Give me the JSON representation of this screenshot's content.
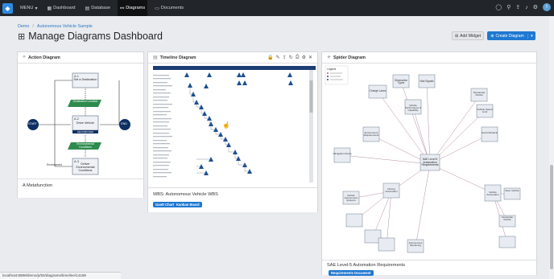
{
  "topbar": {
    "menu_label": "MENU",
    "items": [
      {
        "label": "Dashboard"
      },
      {
        "label": "Database"
      },
      {
        "label": "Diagrams"
      },
      {
        "label": "Documents"
      }
    ],
    "avatar_initial": "I"
  },
  "breadcrumb": {
    "root": "Demo",
    "project": "Autonomous Vehicle Sample"
  },
  "page": {
    "title": "Manage Diagrams Dashboard",
    "add_widget_label": "Add Widget",
    "create_diagram_label": "Create Diagram"
  },
  "action_panel": {
    "title": "Action Diagram",
    "nodes": [
      {
        "id": "A.1",
        "label": "Set a Destination"
      },
      {
        "id": "A.2",
        "label": "Drive Vehicle"
      },
      {
        "id": "A.3",
        "label": "Deliver Environmental Conditions"
      }
    ],
    "items": [
      "Destination Location",
      "Environmental Conditions"
    ],
    "start_label": "START",
    "end_label": "END",
    "branch_label": "Environment",
    "footer_title": "A Metafunction",
    "decomposed_label": "DECOMPOSED"
  },
  "timeline_panel": {
    "title": "Timeline Diagram",
    "footer_title": "WBS: Autonomous Vehicle WBS",
    "tags": [
      "Gantt Chart",
      "Kanban Board"
    ]
  },
  "spider_panel": {
    "title": "Spider Diagram",
    "center_label": "SAE Level 5 Automation Requirements",
    "footer_title": "SAE Level-5 Automation Requirements",
    "tag": "Requirements Document",
    "legend_title": "Legend",
    "nodes": [
      {
        "label": "Obstruction Types"
      },
      {
        "label": "Vital Signals"
      },
      {
        "label": "Change Lanes"
      },
      {
        "label": "Vehicle Performance & Capability"
      },
      {
        "label": "Environment Requirements"
      },
      {
        "label": "Vehicle Speed Limit"
      },
      {
        "label": "Driving Automation"
      },
      {
        "label": "Vehicle Automation"
      },
      {
        "label": "Steer Vehicle"
      },
      {
        "label": "Accelerate Vehicle"
      },
      {
        "label": "Decelerate Vehicle"
      },
      {
        "label": "Avoid Obstacle"
      },
      {
        "label": "Navigation Route"
      },
      {
        "label": "Vehicle Autonomous Systems"
      },
      {
        "label": "Autonomous Monitoring"
      }
    ]
  },
  "status_url": "localhost:8888/demo/p/83/diagrams/timeline/14186"
}
